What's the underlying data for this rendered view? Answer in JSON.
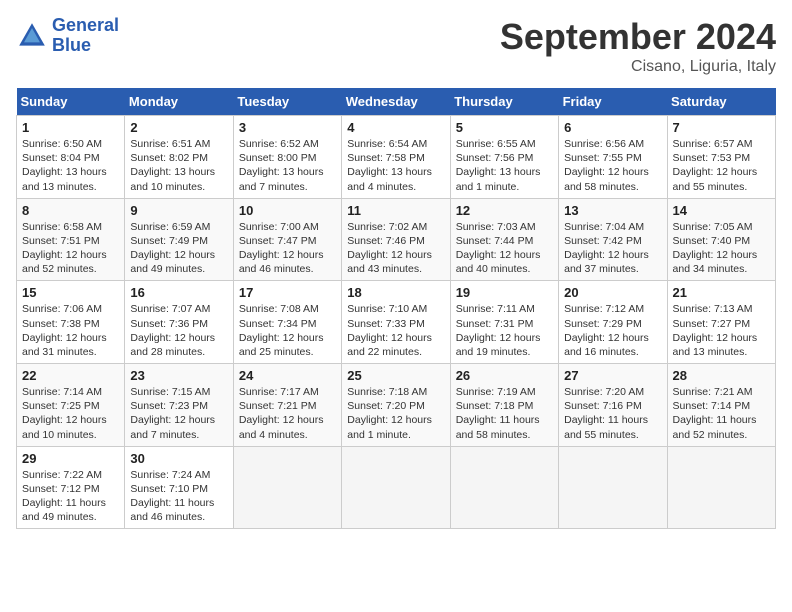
{
  "logo": {
    "line1": "General",
    "line2": "Blue"
  },
  "title": "September 2024",
  "subtitle": "Cisano, Liguria, Italy",
  "days_header": [
    "Sunday",
    "Monday",
    "Tuesday",
    "Wednesday",
    "Thursday",
    "Friday",
    "Saturday"
  ],
  "weeks": [
    [
      {
        "num": "1",
        "info": "Sunrise: 6:50 AM\nSunset: 8:04 PM\nDaylight: 13 hours\nand 13 minutes."
      },
      {
        "num": "2",
        "info": "Sunrise: 6:51 AM\nSunset: 8:02 PM\nDaylight: 13 hours\nand 10 minutes."
      },
      {
        "num": "3",
        "info": "Sunrise: 6:52 AM\nSunset: 8:00 PM\nDaylight: 13 hours\nand 7 minutes."
      },
      {
        "num": "4",
        "info": "Sunrise: 6:54 AM\nSunset: 7:58 PM\nDaylight: 13 hours\nand 4 minutes."
      },
      {
        "num": "5",
        "info": "Sunrise: 6:55 AM\nSunset: 7:56 PM\nDaylight: 13 hours\nand 1 minute."
      },
      {
        "num": "6",
        "info": "Sunrise: 6:56 AM\nSunset: 7:55 PM\nDaylight: 12 hours\nand 58 minutes."
      },
      {
        "num": "7",
        "info": "Sunrise: 6:57 AM\nSunset: 7:53 PM\nDaylight: 12 hours\nand 55 minutes."
      }
    ],
    [
      {
        "num": "8",
        "info": "Sunrise: 6:58 AM\nSunset: 7:51 PM\nDaylight: 12 hours\nand 52 minutes."
      },
      {
        "num": "9",
        "info": "Sunrise: 6:59 AM\nSunset: 7:49 PM\nDaylight: 12 hours\nand 49 minutes."
      },
      {
        "num": "10",
        "info": "Sunrise: 7:00 AM\nSunset: 7:47 PM\nDaylight: 12 hours\nand 46 minutes."
      },
      {
        "num": "11",
        "info": "Sunrise: 7:02 AM\nSunset: 7:46 PM\nDaylight: 12 hours\nand 43 minutes."
      },
      {
        "num": "12",
        "info": "Sunrise: 7:03 AM\nSunset: 7:44 PM\nDaylight: 12 hours\nand 40 minutes."
      },
      {
        "num": "13",
        "info": "Sunrise: 7:04 AM\nSunset: 7:42 PM\nDaylight: 12 hours\nand 37 minutes."
      },
      {
        "num": "14",
        "info": "Sunrise: 7:05 AM\nSunset: 7:40 PM\nDaylight: 12 hours\nand 34 minutes."
      }
    ],
    [
      {
        "num": "15",
        "info": "Sunrise: 7:06 AM\nSunset: 7:38 PM\nDaylight: 12 hours\nand 31 minutes."
      },
      {
        "num": "16",
        "info": "Sunrise: 7:07 AM\nSunset: 7:36 PM\nDaylight: 12 hours\nand 28 minutes."
      },
      {
        "num": "17",
        "info": "Sunrise: 7:08 AM\nSunset: 7:34 PM\nDaylight: 12 hours\nand 25 minutes."
      },
      {
        "num": "18",
        "info": "Sunrise: 7:10 AM\nSunset: 7:33 PM\nDaylight: 12 hours\nand 22 minutes."
      },
      {
        "num": "19",
        "info": "Sunrise: 7:11 AM\nSunset: 7:31 PM\nDaylight: 12 hours\nand 19 minutes."
      },
      {
        "num": "20",
        "info": "Sunrise: 7:12 AM\nSunset: 7:29 PM\nDaylight: 12 hours\nand 16 minutes."
      },
      {
        "num": "21",
        "info": "Sunrise: 7:13 AM\nSunset: 7:27 PM\nDaylight: 12 hours\nand 13 minutes."
      }
    ],
    [
      {
        "num": "22",
        "info": "Sunrise: 7:14 AM\nSunset: 7:25 PM\nDaylight: 12 hours\nand 10 minutes."
      },
      {
        "num": "23",
        "info": "Sunrise: 7:15 AM\nSunset: 7:23 PM\nDaylight: 12 hours\nand 7 minutes."
      },
      {
        "num": "24",
        "info": "Sunrise: 7:17 AM\nSunset: 7:21 PM\nDaylight: 12 hours\nand 4 minutes."
      },
      {
        "num": "25",
        "info": "Sunrise: 7:18 AM\nSunset: 7:20 PM\nDaylight: 12 hours\nand 1 minute."
      },
      {
        "num": "26",
        "info": "Sunrise: 7:19 AM\nSunset: 7:18 PM\nDaylight: 11 hours\nand 58 minutes."
      },
      {
        "num": "27",
        "info": "Sunrise: 7:20 AM\nSunset: 7:16 PM\nDaylight: 11 hours\nand 55 minutes."
      },
      {
        "num": "28",
        "info": "Sunrise: 7:21 AM\nSunset: 7:14 PM\nDaylight: 11 hours\nand 52 minutes."
      }
    ],
    [
      {
        "num": "29",
        "info": "Sunrise: 7:22 AM\nSunset: 7:12 PM\nDaylight: 11 hours\nand 49 minutes."
      },
      {
        "num": "30",
        "info": "Sunrise: 7:24 AM\nSunset: 7:10 PM\nDaylight: 11 hours\nand 46 minutes."
      },
      null,
      null,
      null,
      null,
      null
    ]
  ]
}
